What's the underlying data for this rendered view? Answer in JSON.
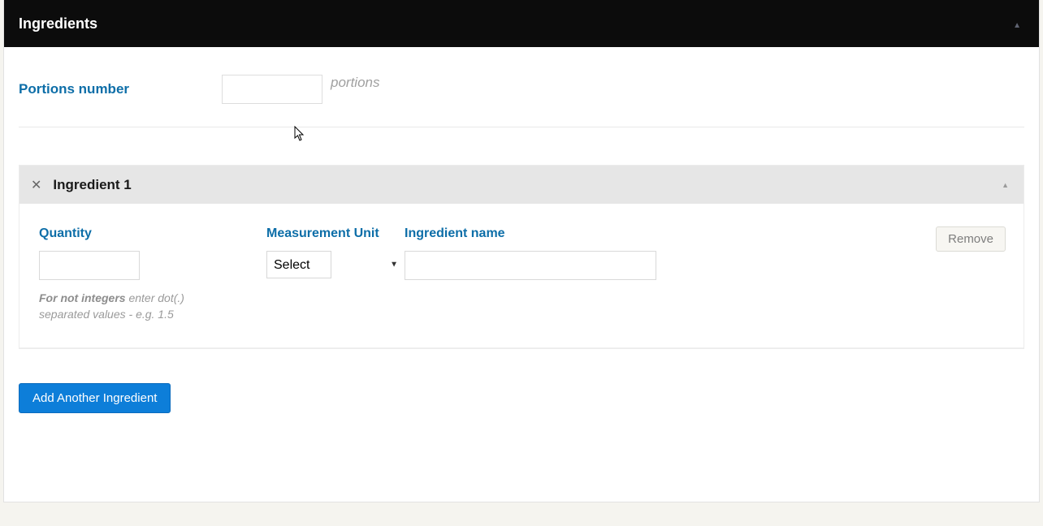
{
  "panel": {
    "title": "Ingredients"
  },
  "portions": {
    "label": "Portions number",
    "value": "",
    "suffix": "portions"
  },
  "ingredient": {
    "header_title": "Ingredient 1",
    "quantity_label": "Quantity",
    "quantity_value": "",
    "quantity_hint_strong": "For not integers",
    "quantity_hint_rest": " enter dot(.) separated values - e.g. 1.5",
    "unit_label": "Measurement Unit",
    "unit_selected": "Select",
    "name_label": "Ingredient name",
    "name_value": "",
    "remove_label": "Remove"
  },
  "add_button_label": "Add Another Ingredient"
}
